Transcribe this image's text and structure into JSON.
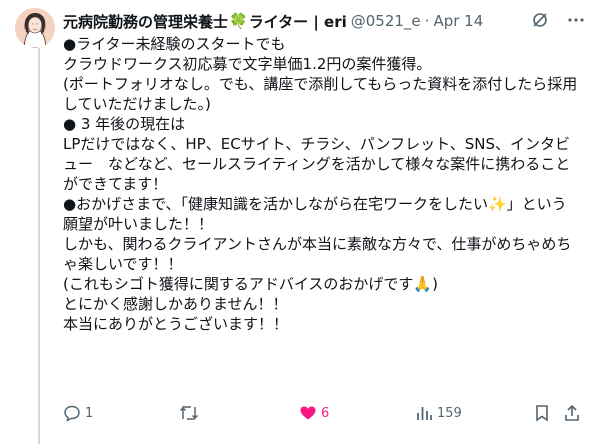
{
  "tweet": {
    "author_name": "元病院勤務の管理栄養士",
    "author_name_suffix": "ライター | eri",
    "clover": "🍀",
    "handle": "@0521_e",
    "separator": "·",
    "date": "Apr 14",
    "lines": [
      "●ライター未経験のスタートでも",
      "クラウドワークス初応募で文字単価1.2円の案件獲得。",
      "(ポートフォリオなし。でも、講座で添削してもらった資料を添付したら採用",
      "していただけました。)",
      "",
      "● 3 年後の現在は",
      "LPだけではなく、HP、ECサイト、チラシ、パンフレット、SNS、インタビ",
      "ュー　などなど、セールスライティングを活かして様々な案件に携わること",
      "ができてます！",
      "",
      "●おかげさまで、「健康知識を活かしながら在宅ワークをしたい✨」という",
      "願望が叶いました！！",
      "しかも、関わるクライアントさんが本当に素敵な方々で、仕事がめちゃめち",
      "ゃ楽しいです！！",
      "(これもシゴト獲得に関するアドバイスのおかげです🙏)",
      "",
      "とにかく感謝しかありません！！",
      "本当にありがとうございます！！"
    ],
    "actions": {
      "replies": "1",
      "retweets": "",
      "likes": "6",
      "views": "159"
    },
    "colors": {
      "like": "#f91880",
      "muted": "#536471",
      "text": "#0f1419",
      "thread_line": "#cfd9de"
    },
    "icons": [
      "grok-icon",
      "more-icon",
      "reply-icon",
      "retweet-icon",
      "like-icon",
      "views-icon",
      "bookmark-icon",
      "share-icon"
    ]
  }
}
